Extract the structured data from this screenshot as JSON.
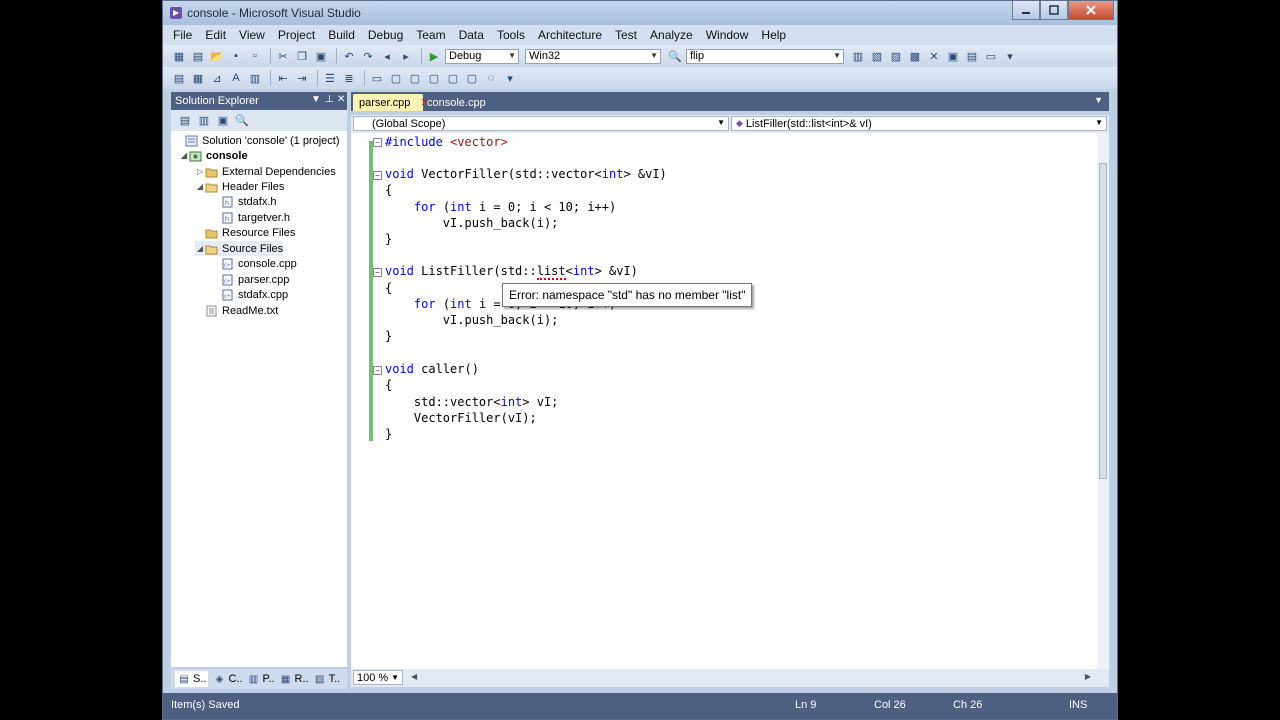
{
  "window": {
    "title": "console - Microsoft Visual Studio",
    "min": "0",
    "max": "1",
    "close": "r"
  },
  "menu": [
    "File",
    "Edit",
    "View",
    "Project",
    "Build",
    "Debug",
    "Team",
    "Data",
    "Tools",
    "Architecture",
    "Test",
    "Analyze",
    "Window",
    "Help"
  ],
  "toolbar": {
    "config": "Debug",
    "platform": "Win32",
    "find": "flip"
  },
  "solution_explorer": {
    "title": "Solution Explorer",
    "tree": [
      {
        "label": "Solution 'console' (1 project)",
        "bold": false
      },
      {
        "label": "console",
        "bold": true
      },
      {
        "label": "External Dependencies",
        "bold": false
      },
      {
        "label": "Header Files",
        "bold": false
      },
      {
        "label": "stdafx.h",
        "bold": false
      },
      {
        "label": "targetver.h",
        "bold": false
      },
      {
        "label": "Resource Files",
        "bold": false
      },
      {
        "label": "Source Files",
        "bold": false
      },
      {
        "label": "console.cpp",
        "bold": false
      },
      {
        "label": "parser.cpp",
        "bold": false
      },
      {
        "label": "stdafx.cpp",
        "bold": false
      },
      {
        "label": "ReadMe.txt",
        "bold": false
      }
    ],
    "tabs": [
      "S..",
      "C..",
      "P..",
      "R..",
      "T.."
    ]
  },
  "editor": {
    "tabs": [
      "parser.cpp",
      "console.cpp"
    ],
    "scope": "(Global Scope)",
    "member": "ListFiller(std::list<int>& vI)",
    "tooltip": "Error: namespace \"std\" has no member \"list\"",
    "zoom": "100 %"
  },
  "status": {
    "message": "Item(s) Saved",
    "ln": "Ln 9",
    "col": "Col 26",
    "ch": "Ch 26",
    "mode": "INS"
  }
}
